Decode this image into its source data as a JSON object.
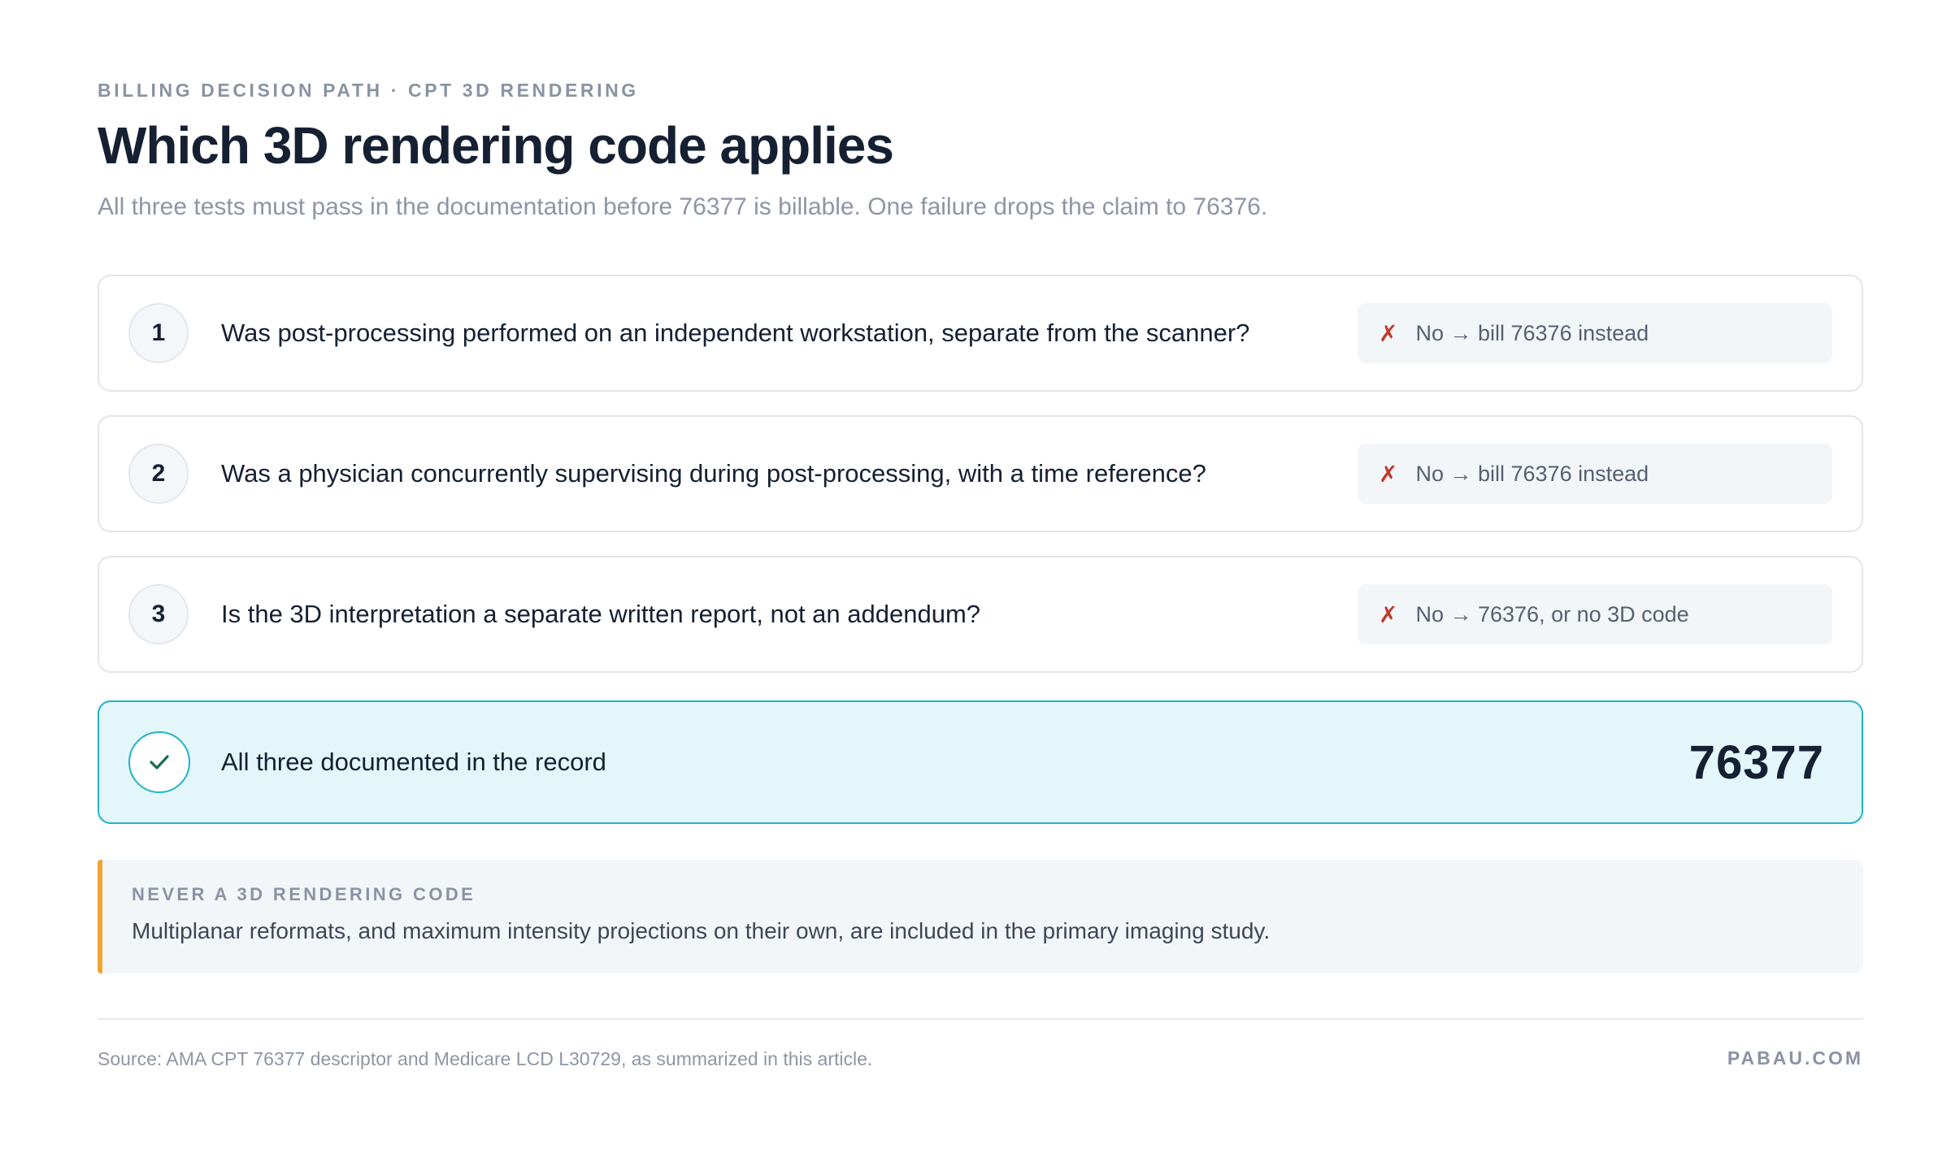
{
  "header": {
    "eyebrow": "BILLING DECISION PATH · CPT 3D RENDERING",
    "title": "Which 3D rendering code applies",
    "subtitle": "All three tests must pass in the documentation before 76377 is billable. One failure drops the claim to 76376."
  },
  "tests": [
    {
      "number": "1",
      "question": "Was post-processing performed on an independent workstation, separate from the scanner?",
      "fail_mark": "✗",
      "outcome": "No → bill 76376 instead"
    },
    {
      "number": "2",
      "question": "Was a physician concurrently supervising during post-processing, with a time reference?",
      "fail_mark": "✗",
      "outcome": "No → bill 76376 instead"
    },
    {
      "number": "3",
      "question": "Is the 3D interpretation a separate written report, not an addendum?",
      "fail_mark": "✗",
      "outcome": "No → 76376, or no 3D code"
    }
  ],
  "result": {
    "icon": "check-icon",
    "label": "All three documented in the record",
    "code": "76377"
  },
  "note": {
    "heading": "NEVER A 3D RENDERING CODE",
    "body": "Multiplanar reformats, and maximum intensity projections on their own, are included in the primary imaging study."
  },
  "footer": {
    "source": "Source: AMA CPT 76377 descriptor and Medicare LCD L30729, as summarized in this article.",
    "brand": "PABAU.COM"
  },
  "colors": {
    "text_primary": "#152033",
    "text_muted": "#8e96a4",
    "fail_red": "#c0392b",
    "pass_teal": "#22b3c9",
    "pass_bg": "#e3f6fa",
    "check_green": "#1c6b4a",
    "note_accent": "#f0a431"
  }
}
